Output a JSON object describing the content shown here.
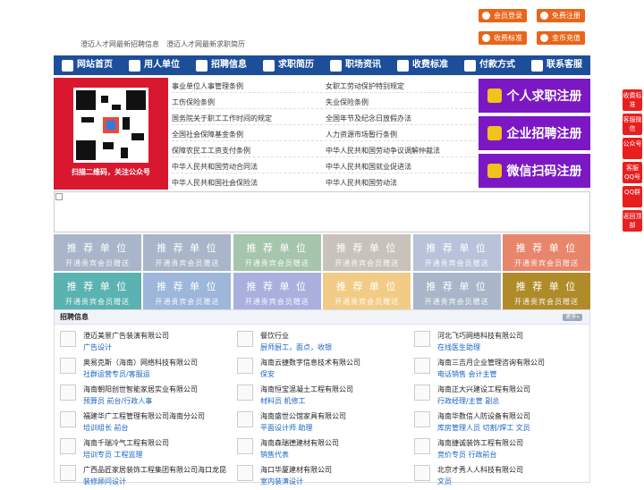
{
  "header": {
    "link1": "澄迈人才网最新招聘信息",
    "link2": "澄迈人才网最新求职简历",
    "buttons": [
      "会员登录",
      "免费注册",
      "收费标准",
      "金币充值"
    ]
  },
  "nav": [
    "网站首页",
    "用人单位",
    "招聘信息",
    "求职简历",
    "职场资讯",
    "收费标准",
    "付款方式",
    "联系客服"
  ],
  "qr": {
    "caption": "扫描二维码，关注公众号"
  },
  "links": {
    "left": [
      "事业单位人事管理条例",
      "工伤保险条例",
      "国务院关于职工工作时间的规定",
      "全国社会保障基金条例",
      "保障农民工工资支付条例",
      "中华人民共和国劳动合同法",
      "中华人民共和国社会保险法"
    ],
    "right": [
      "女职工劳动保护特别规定",
      "失业保险条例",
      "全国年节及纪念日放假办法",
      "人力资源市场暂行条例",
      "中华人民共和国劳动争议调解仲裁法",
      "中华人民共和国就业促进法",
      "中华人民共和国劳动法"
    ]
  },
  "register": [
    "个人求职注册",
    "企业招聘注册",
    "微信扫码注册"
  ],
  "tiles": {
    "title": "推 荐 单 位",
    "sub": "开通贵宾会员赠送",
    "colors": [
      "#a9b6c9",
      "#a9b6c9",
      "#a6c5ad",
      "#c9c2bb",
      "#b8c3da",
      "#e8866c",
      "#5ab3b0",
      "#9db6d9",
      "#aab0de",
      "#f2cc86",
      "#a9b6c9",
      "#b08b2a"
    ]
  },
  "jobs": {
    "title": "招聘信息",
    "more": "更多»",
    "items": [
      {
        "company": "澄迈美景广告装演有限公司",
        "positions": "广告设计"
      },
      {
        "company": "餐饮行业",
        "positions": "厨师厨工，面点，收银"
      },
      {
        "company": "河北飞巧网络科技有限公司",
        "positions": "在线医生助理"
      },
      {
        "company": "奥易克斯（海南）网络科技有限公司",
        "positions": "社群运营专员/客服运"
      },
      {
        "company": "海南云捷数字信息技术有限公司",
        "positions": "保安"
      },
      {
        "company": "海南三吉月企业管理咨询有限公司",
        "positions": "电话销售 会计主管"
      },
      {
        "company": "海南朝阳创世智能家居实业有限公司",
        "positions": "预算员 前台/行政人事"
      },
      {
        "company": "海南恒宝混凝土工程有限公司",
        "positions": "材料员 机修工"
      },
      {
        "company": "海南正大兴建设工程有限公司",
        "positions": "行政经理/主管 副总"
      },
      {
        "company": "福建华广工程管理有限公司海南分公司",
        "positions": "培训组长 前台"
      },
      {
        "company": "海南盛世公馆家具有限公司",
        "positions": "平面设计师 助理"
      },
      {
        "company": "海南华数信人防设备有限公司",
        "positions": "库房管理人员 切割/焊工 文员"
      },
      {
        "company": "海南千瑞冷气工程有限公司",
        "positions": "培训专员 工程监理"
      },
      {
        "company": "海南森瑞德建材有限公司",
        "positions": "销售代表"
      },
      {
        "company": "海南捷诚装饰工程有限公司",
        "positions": "竞价专员 行政前台"
      },
      {
        "company": "广西品匠家居装饰工程集团有限公司海口龙昆",
        "positions": "装修顾问设计"
      },
      {
        "company": "海口华厦建材有限公司",
        "positions": "室内装潢设计"
      },
      {
        "company": "北京才秀人人科技有限公司",
        "positions": "文员"
      }
    ]
  },
  "sidebar": [
    "收费标准",
    "客服微信",
    "公众号",
    "客服QQ号",
    "QQ群",
    "返回顶部"
  ]
}
